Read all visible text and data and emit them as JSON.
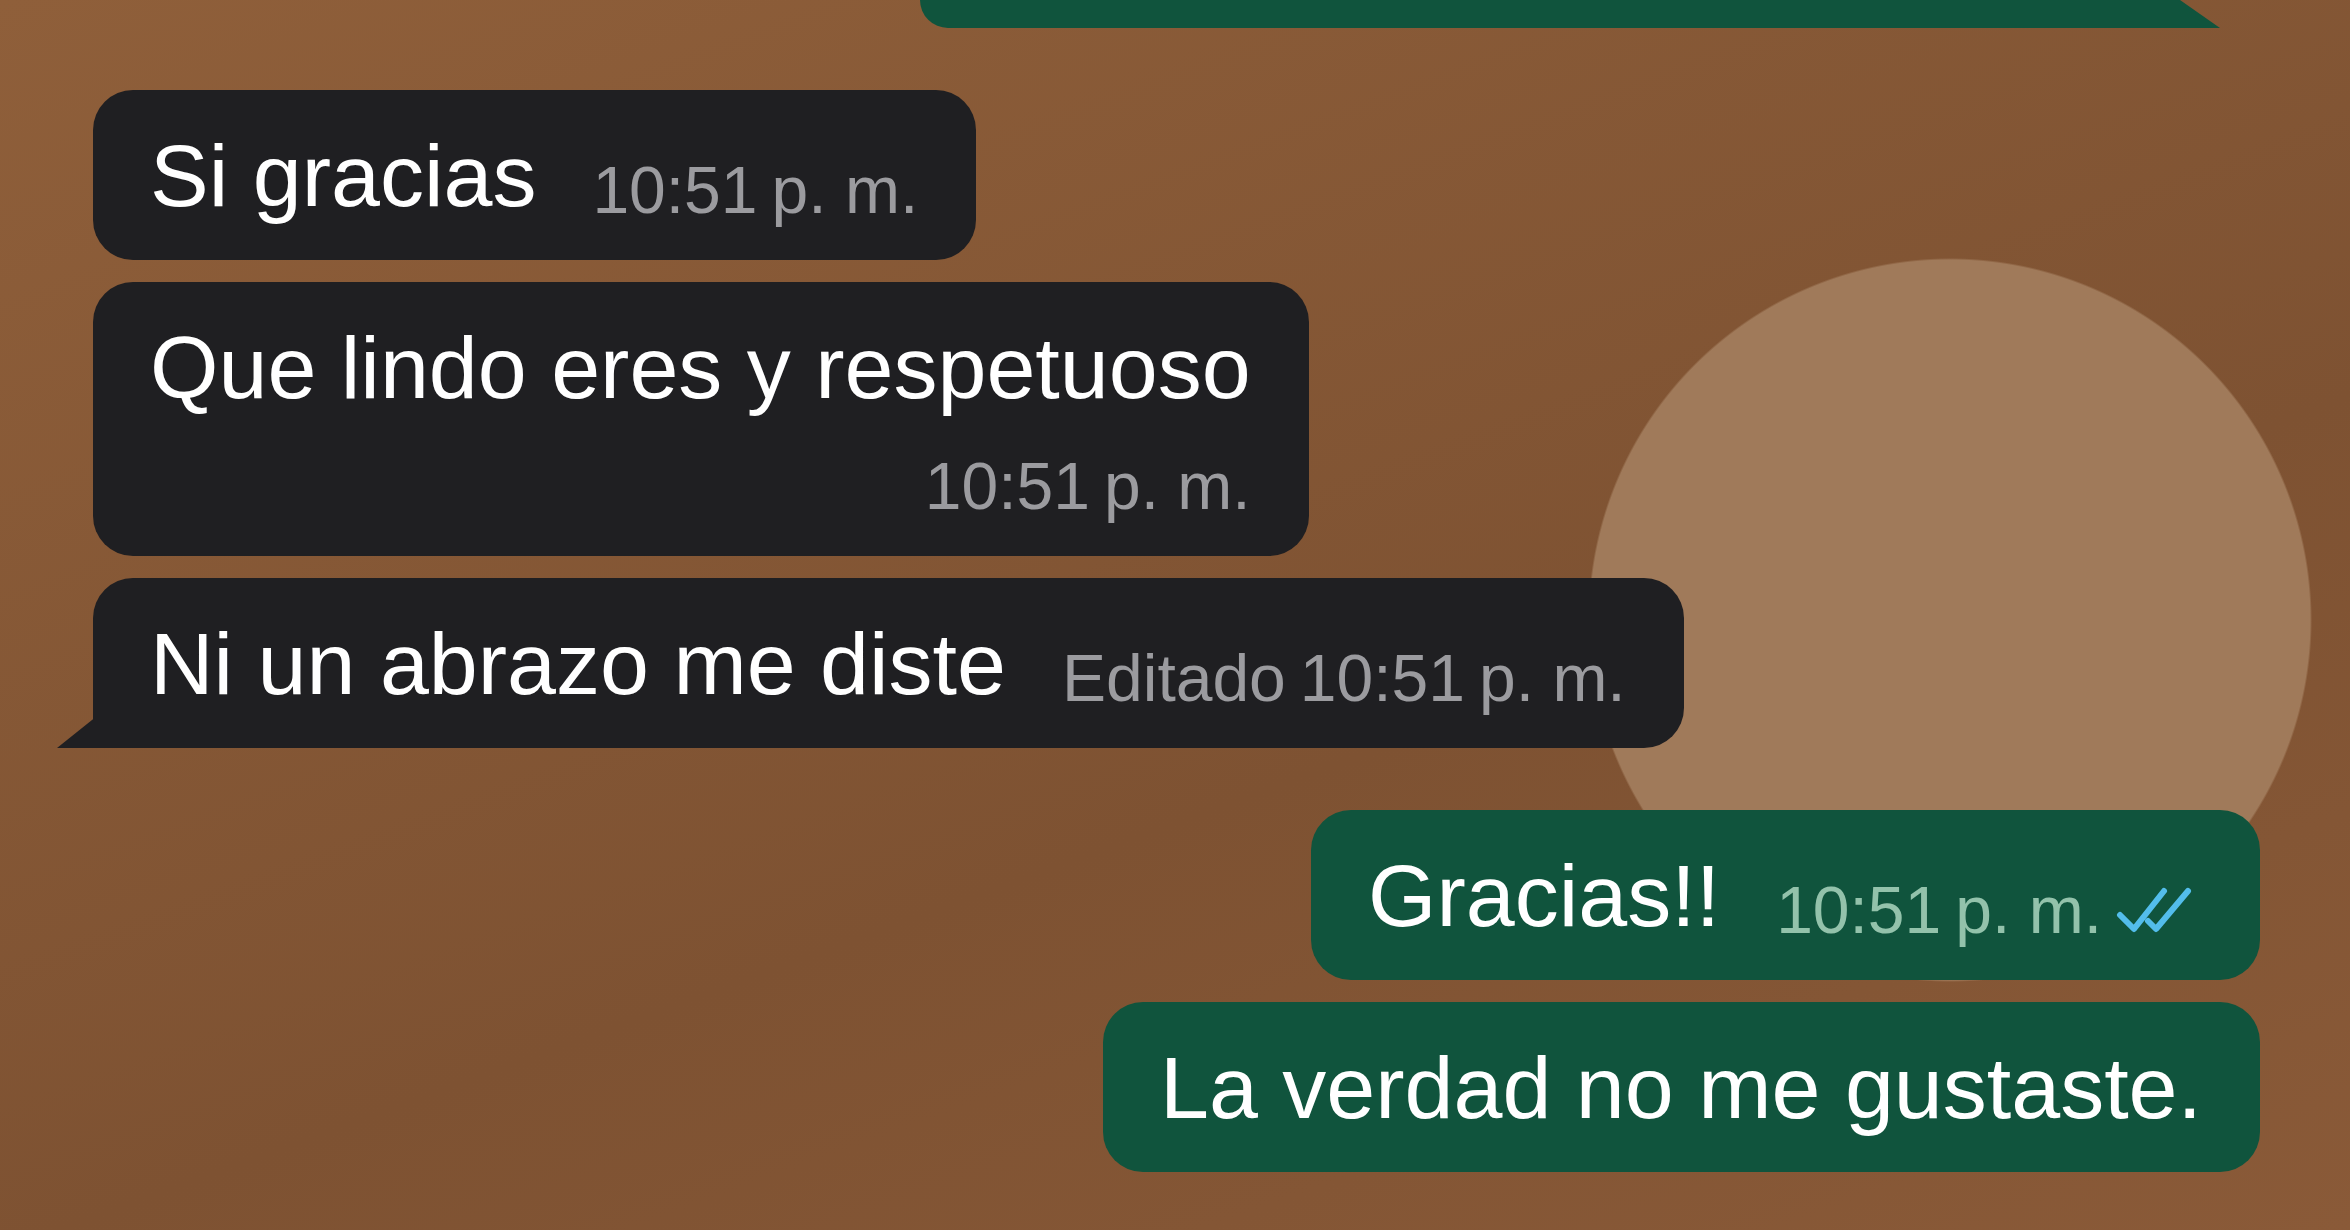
{
  "messages": [
    {
      "kind": "outgoing_partial",
      "tail": true
    },
    {
      "kind": "incoming",
      "text": "Si gracias",
      "time": "10:51",
      "ampm": "p. m.",
      "time_below": false,
      "tail": false
    },
    {
      "kind": "incoming",
      "text": "Que lindo eres y respetuoso",
      "time": "10:51",
      "ampm": "p. m.",
      "time_below": true,
      "tail": false
    },
    {
      "kind": "incoming",
      "text": "Ni un abrazo me diste",
      "edited_label": "Editado",
      "time": "10:51",
      "ampm": "p. m.",
      "time_below": false,
      "tail": true
    },
    {
      "kind": "outgoing",
      "text": "Gracias!!",
      "time": "10:51",
      "ampm": "p. m.",
      "read": true,
      "time_below": false,
      "tail": false
    },
    {
      "kind": "outgoing",
      "text": "La verdad no me gustaste.",
      "time_below": false,
      "tail": false
    }
  ]
}
